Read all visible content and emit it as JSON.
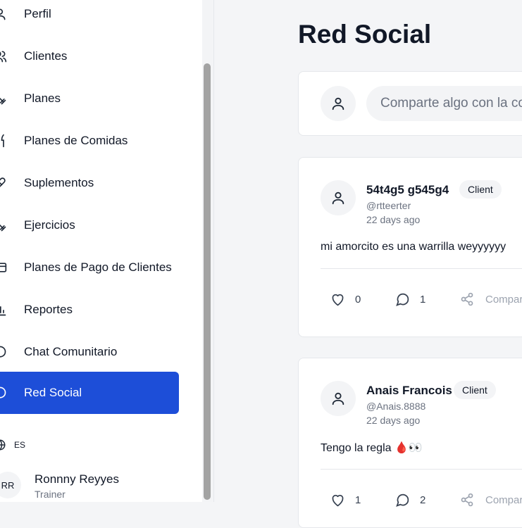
{
  "sidebar": {
    "items": [
      {
        "label": "Perfil",
        "icon": "user-icon"
      },
      {
        "label": "Clientes",
        "icon": "users-icon"
      },
      {
        "label": "Planes",
        "icon": "dumbbell-icon"
      },
      {
        "label": "Planes de Comidas",
        "icon": "utensils-icon"
      },
      {
        "label": "Suplementos",
        "icon": "pill-icon"
      },
      {
        "label": "Ejercicios",
        "icon": "dumbbell-icon"
      },
      {
        "label": "Planes de Pago de Clientes",
        "icon": "credit-card-icon"
      },
      {
        "label": "Reportes",
        "icon": "bar-chart-icon"
      },
      {
        "label": "Chat Comunitario",
        "icon": "message-circle-icon"
      },
      {
        "label": "Red Social",
        "icon": "message-circle-icon",
        "active": true
      }
    ],
    "language": "ES",
    "user": {
      "initials": "RR",
      "name": "Ronnny Reyyes",
      "role": "Trainer"
    }
  },
  "main": {
    "title": "Red Social",
    "composer": {
      "placeholder": "Comparte algo con la comunidad..."
    },
    "posts": [
      {
        "author": "54t4g5 g545g4",
        "badge": "Client",
        "handle": "@rtteerter",
        "time": "22 days ago",
        "text": "mi amorcito es una warrilla weyyyyyy",
        "likes": "0",
        "comments": "1",
        "share_label": "Compartir"
      },
      {
        "author": "Anais Francois",
        "badge": "Client",
        "handle": "@Anais.8888",
        "time": "22 days ago",
        "text": "Tengo la regla 🩸👀",
        "likes": "1",
        "comments": "2",
        "share_label": "Compartir"
      }
    ]
  },
  "colors": {
    "accent": "#1d4ed8",
    "background": "#f4f5f7",
    "card": "#ffffff",
    "muted": "#6b7280"
  }
}
